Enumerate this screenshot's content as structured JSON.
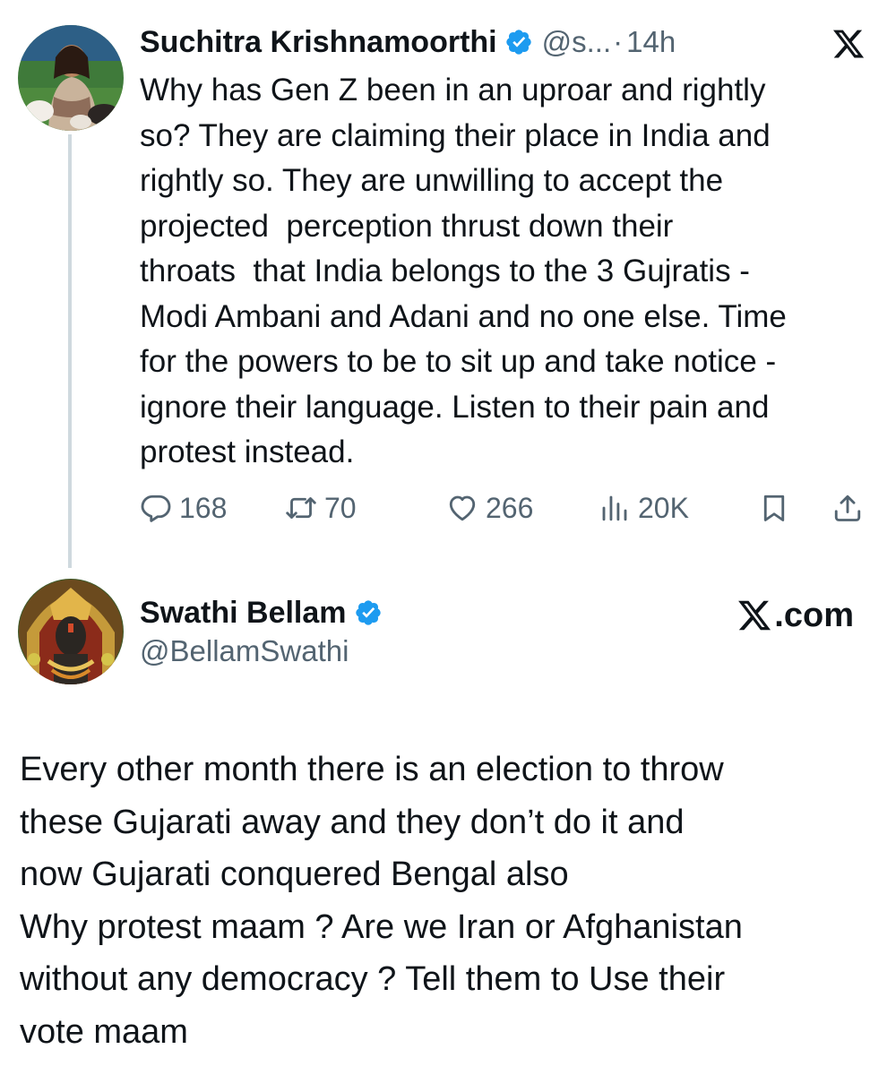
{
  "colors": {
    "text_primary": "#0f1419",
    "text_secondary": "#536471",
    "verified_blue": "#1d9bf0",
    "thread_line": "#cfd9de"
  },
  "tweet1": {
    "display_name": "Suchitra Krishnamoorthi",
    "verified_icon": "verified-badge-icon",
    "handle": "@s...",
    "separator": "·",
    "time": "14h",
    "text": "Why has Gen Z been in an uproar and rightly\nso? They are claiming their place in India and\nrightly so. They are unwilling to accept the\nprojected  perception thrust down their\nthroats  that India belongs to the 3 Gujratis -\nModi Ambani and Adani and no one else. Time\nfor the powers to be to sit up and take notice -\nignore their language. Listen to their pain and\nprotest instead.",
    "actions": {
      "replies": "168",
      "reposts": "70",
      "likes": "266",
      "views": "20K"
    }
  },
  "tweet2": {
    "display_name": "Swathi Bellam",
    "verified_icon": "verified-badge-icon",
    "handle": "@BellamSwathi",
    "source_label": ".com",
    "text": "Every other month there is an election to throw\nthese Gujarati away and they don’t do it and\nnow Gujarati conquered Bengal also\nWhy protest maam ? Are we Iran or Afghanistan\nwithout any democracy ? Tell them to Use their\nvote maam"
  }
}
